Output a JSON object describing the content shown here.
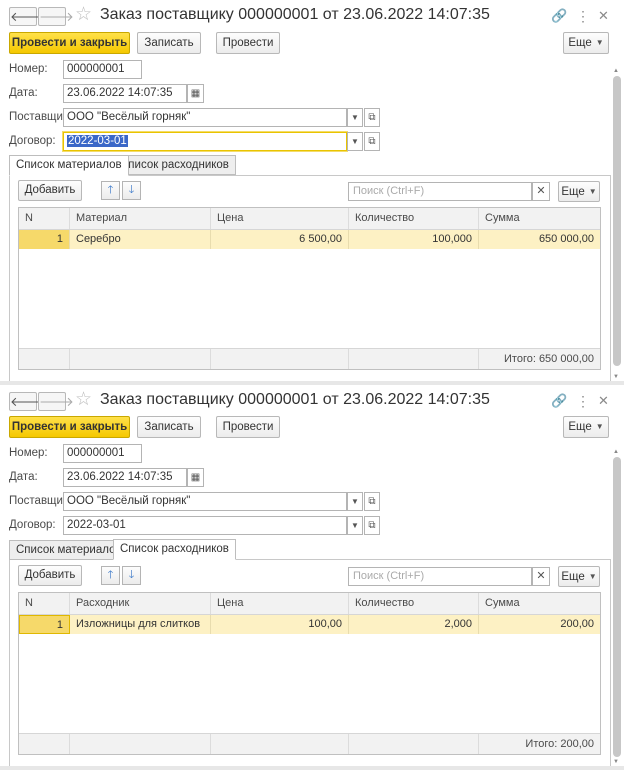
{
  "windows": [
    {
      "title": "Заказ поставщику 000000001 от 23.06.2022 14:07:35",
      "buttons": {
        "post_close": "Провести и закрыть",
        "save": "Записать",
        "post": "Провести",
        "more": "Еще"
      },
      "fields": {
        "number_label": "Номер:",
        "number": "000000001",
        "date_label": "Дата:",
        "date": "23.06.2022 14:07:35",
        "supplier_label": "Поставщик:",
        "supplier": "ООО \"Весёлый горняк\"",
        "contract_label": "Договор:",
        "contract": "2022-03-01"
      },
      "tabs": [
        "Список материалов",
        "Список расходников"
      ],
      "active_tab": 0,
      "table_toolbar": {
        "add": "Добавить",
        "search_placeholder": "Поиск (Ctrl+F)",
        "more": "Еще"
      },
      "columns": [
        "N",
        "Материал",
        "Цена",
        "Количество",
        "Сумма"
      ],
      "rows": [
        {
          "n": "1",
          "item": "Серебро",
          "price": "6 500,00",
          "qty": "100,000",
          "sum": "650 000,00"
        }
      ],
      "total": "Итого: 650 000,00"
    },
    {
      "title": "Заказ поставщику 000000001 от 23.06.2022 14:07:35",
      "buttons": {
        "post_close": "Провести и закрыть",
        "save": "Записать",
        "post": "Провести",
        "more": "Еще"
      },
      "fields": {
        "number_label": "Номер:",
        "number": "000000001",
        "date_label": "Дата:",
        "date": "23.06.2022 14:07:35",
        "supplier_label": "Поставщик:",
        "supplier": "ООО \"Весёлый горняк\"",
        "contract_label": "Договор:",
        "contract": "2022-03-01"
      },
      "tabs": [
        "Список материалов",
        "Список расходников"
      ],
      "active_tab": 1,
      "table_toolbar": {
        "add": "Добавить",
        "search_placeholder": "Поиск (Ctrl+F)",
        "more": "Еще"
      },
      "columns": [
        "N",
        "Расходник",
        "Цена",
        "Количество",
        "Сумма"
      ],
      "rows": [
        {
          "n": "1",
          "item": "Изложницы для слитков",
          "price": "100,00",
          "qty": "2,000",
          "sum": "200,00"
        }
      ],
      "total": "Итого: 200,00"
    }
  ],
  "icons": {
    "back": "arrow-left-icon",
    "forward": "arrow-right-icon",
    "favorite": "star-icon",
    "link": "link-icon",
    "menu": "more-vertical-icon",
    "close": "close-icon"
  }
}
